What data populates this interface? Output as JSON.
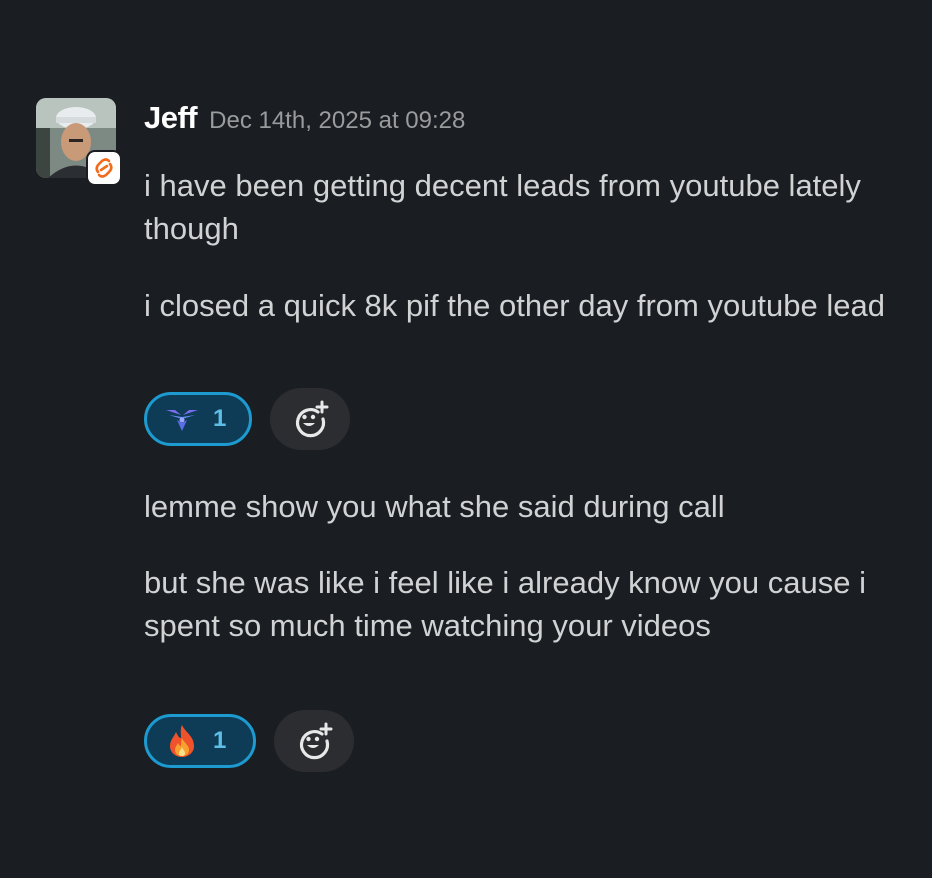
{
  "message": {
    "author": "Jeff",
    "timestamp": "Dec 14th, 2025 at 09:28",
    "paragraphs": [
      "i have been getting decent leads from youtube lately though",
      "i closed a quick 8k pif the other day from youtube lead",
      "lemme show you what she said during call",
      "but she was like i feel like i already know you cause i spent so much time watching your videos"
    ],
    "avatar_badge_icon": "orange-link-badge-icon",
    "reactions": [
      {
        "emoji": "winged-emblem-icon",
        "count": "1",
        "selected": true
      },
      {
        "emoji": "fire-icon",
        "count": "1",
        "selected": true
      }
    ],
    "add_reaction_icon": "add-reaction-icon"
  },
  "colors": {
    "background": "#1a1d21",
    "text": "#d1d2d3",
    "timestamp": "#9a9b9d",
    "reaction_border": "#1d9bd1",
    "reaction_bg": "#0e3b55",
    "reaction_count": "#5ebee6",
    "add_reaction_bg": "#2b2d31"
  }
}
